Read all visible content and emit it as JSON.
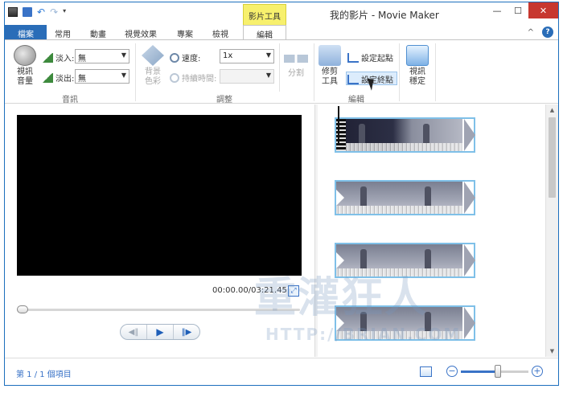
{
  "window": {
    "title": "我的影片 - Movie Maker",
    "context_tab_group": "影片工具",
    "controls": {
      "minimize": "—",
      "maximize": "☐",
      "close": "✕"
    }
  },
  "quick_access": {
    "undo": "↶",
    "redo": "↷",
    "customize": "▾"
  },
  "tabs": {
    "file": "檔案",
    "home": "常用",
    "animations": "動畫",
    "visual_effects": "視覺效果",
    "project": "專案",
    "view": "檢視",
    "edit": "編輯",
    "collapse": "^",
    "help": "?"
  },
  "ribbon": {
    "audio": {
      "video_volume": "視訊\n音量",
      "fade_in_label": "淡入:",
      "fade_in_value": "無",
      "fade_out_label": "淡出:",
      "fade_out_value": "無",
      "group_label": "音訊"
    },
    "adjust": {
      "background_color": "背景\n色彩",
      "speed_label": "速度:",
      "speed_value": "1x",
      "duration_label": "持續時間:",
      "duration_value": "",
      "split": "分割",
      "group_label": "調整"
    },
    "editing": {
      "trim_tool": "修剪\n工具",
      "set_start_point": "設定起點",
      "set_end_point": "設定終點",
      "group_label": "編輯"
    },
    "stabilization": {
      "video_stabilization": "視訊\n穩定"
    }
  },
  "preview": {
    "timecode": "00:00.00/03:21.45",
    "seek_position": 0,
    "controls": {
      "previous_frame": "◀‖",
      "play": "▶",
      "next_frame": "‖▶"
    }
  },
  "storyboard": {
    "clip_count": 4
  },
  "watermark": {
    "text": "重灌狂人",
    "url": "HTTP://BRIAN.COM"
  },
  "status": {
    "item_text": "第 1 / 1 個項目",
    "zoom_minus": "−",
    "zoom_plus": "+",
    "zoom_level": 0.55
  },
  "colors": {
    "accent": "#2a6db8",
    "context_tab": "#f7f06d",
    "close": "#c7372f",
    "clip_border": "#7fc0e8"
  }
}
